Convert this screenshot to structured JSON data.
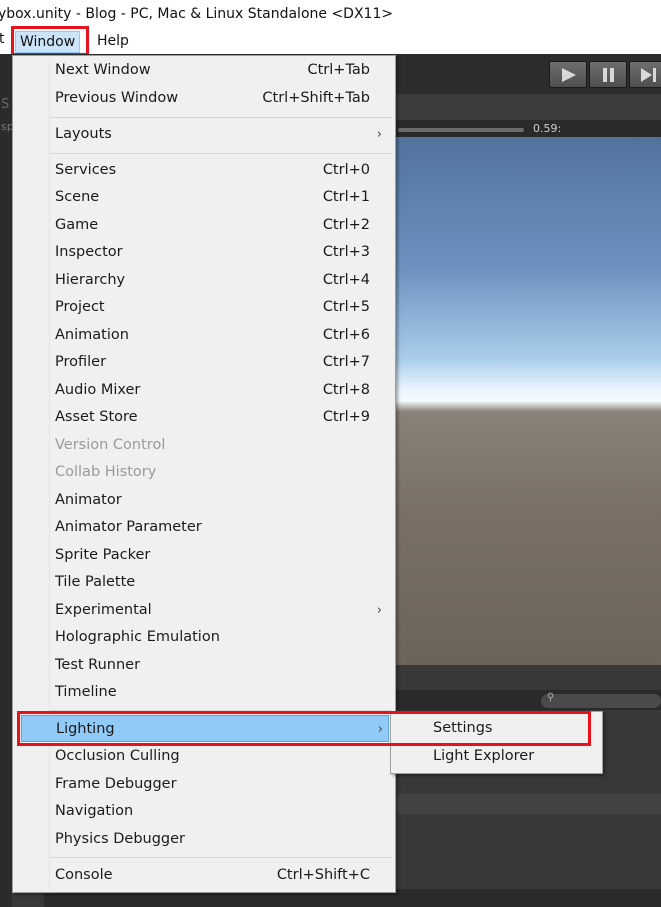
{
  "titlebar": {
    "title": "ybox.unity - Blog - PC, Mac & Linux Standalone <DX11>"
  },
  "menubar": {
    "fragment": "t",
    "window_label": "Window",
    "help_label": "Help"
  },
  "editor": {
    "time_label": "0.59:",
    "side_fragment_1": "S",
    "side_fragment_2": "sp"
  },
  "window_menu": {
    "items": [
      {
        "label": "Next Window",
        "shortcut": "Ctrl+Tab"
      },
      {
        "label": "Previous Window",
        "shortcut": "Ctrl+Shift+Tab"
      },
      {
        "label": "Layouts",
        "shortcut": "",
        "submenu": true
      },
      {
        "label": "Services",
        "shortcut": "Ctrl+0"
      },
      {
        "label": "Scene",
        "shortcut": "Ctrl+1"
      },
      {
        "label": "Game",
        "shortcut": "Ctrl+2"
      },
      {
        "label": "Inspector",
        "shortcut": "Ctrl+3"
      },
      {
        "label": "Hierarchy",
        "shortcut": "Ctrl+4"
      },
      {
        "label": "Project",
        "shortcut": "Ctrl+5"
      },
      {
        "label": "Animation",
        "shortcut": "Ctrl+6"
      },
      {
        "label": "Profiler",
        "shortcut": "Ctrl+7"
      },
      {
        "label": "Audio Mixer",
        "shortcut": "Ctrl+8"
      },
      {
        "label": "Asset Store",
        "shortcut": "Ctrl+9"
      },
      {
        "label": "Version Control",
        "shortcut": "",
        "disabled": true
      },
      {
        "label": "Collab History",
        "shortcut": "",
        "disabled": true
      },
      {
        "label": "Animator",
        "shortcut": ""
      },
      {
        "label": "Animator Parameter",
        "shortcut": ""
      },
      {
        "label": "Sprite Packer",
        "shortcut": ""
      },
      {
        "label": "Tile Palette",
        "shortcut": ""
      },
      {
        "label": "Experimental",
        "shortcut": "",
        "submenu": true
      },
      {
        "label": "Holographic Emulation",
        "shortcut": ""
      },
      {
        "label": "Test Runner",
        "shortcut": ""
      },
      {
        "label": "Timeline",
        "shortcut": ""
      },
      {
        "label": "Lighting",
        "shortcut": "",
        "submenu": true,
        "active": true
      },
      {
        "label": "Occlusion Culling",
        "shortcut": ""
      },
      {
        "label": "Frame Debugger",
        "shortcut": ""
      },
      {
        "label": "Navigation",
        "shortcut": ""
      },
      {
        "label": "Physics Debugger",
        "shortcut": ""
      },
      {
        "label": "Console",
        "shortcut": "Ctrl+Shift+C"
      }
    ],
    "arrow_glyph": "›"
  },
  "lighting_submenu": {
    "items": [
      {
        "label": "Settings"
      },
      {
        "label": "Light Explorer"
      }
    ]
  },
  "colors": {
    "highlight_red": "#e8121d",
    "menu_active": "#91c9f7",
    "menu_bg": "#f0f0f0"
  }
}
